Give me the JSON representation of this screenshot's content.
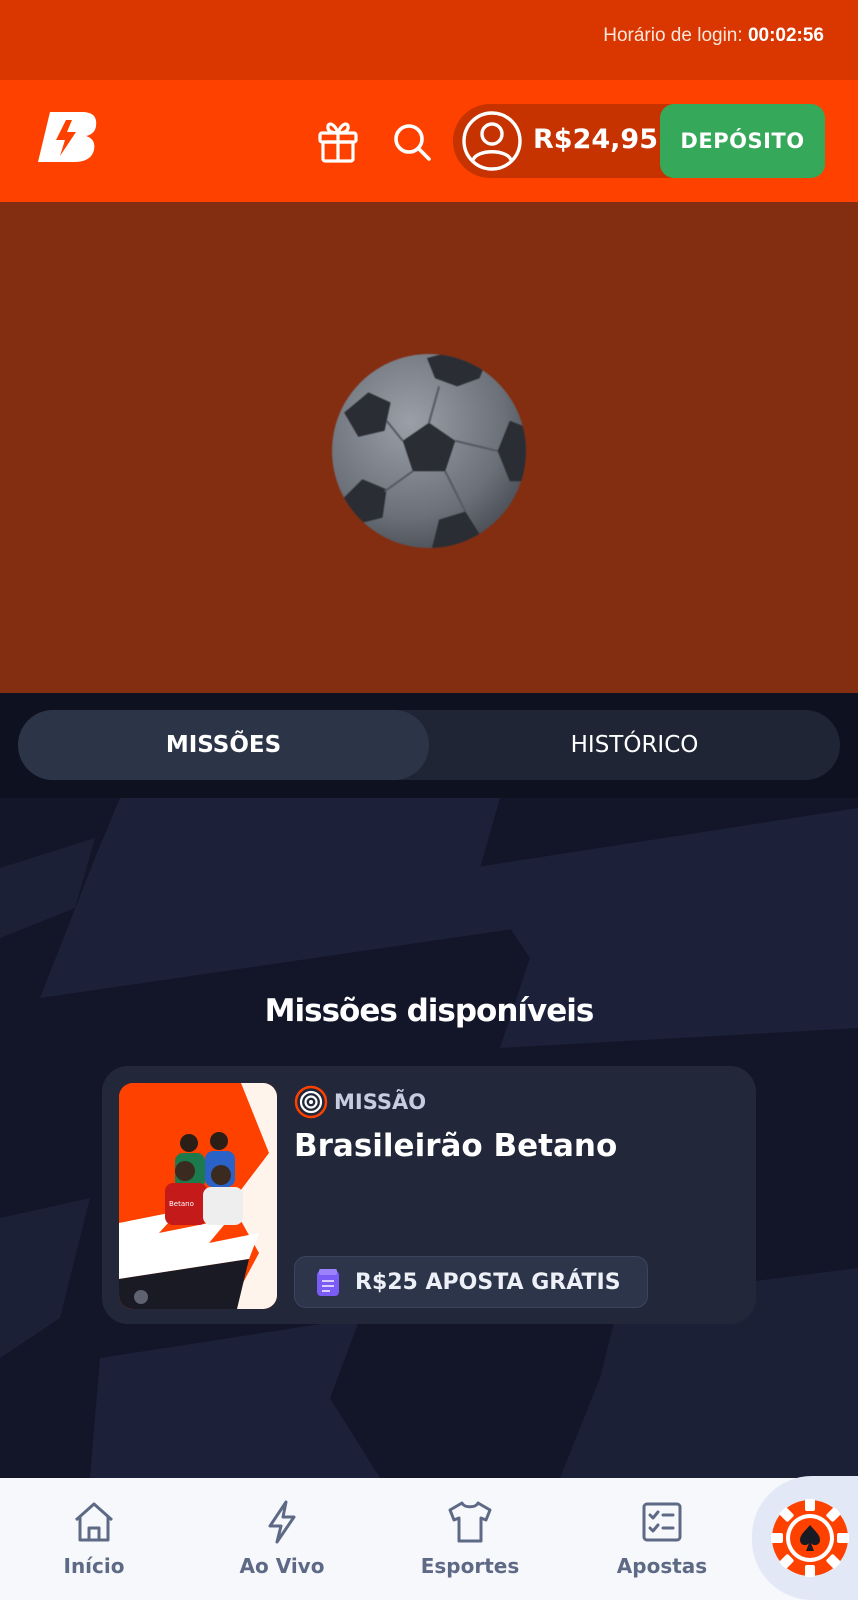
{
  "status_bar": {
    "login_label": "Horário de login:",
    "login_time": "00:02:56"
  },
  "header": {
    "logo_letter": "B",
    "balance": "R$24,95",
    "deposit_label": "DEPÓSITO",
    "icons": [
      "gift-icon",
      "search-icon",
      "user-avatar-icon"
    ]
  },
  "hero": {
    "image": "soccer-ball"
  },
  "tabs": {
    "items": [
      {
        "label": "MISSÕES",
        "active": true
      },
      {
        "label": "HISTÓRICO",
        "active": false
      }
    ]
  },
  "missions": {
    "section_title": "Missões disponíveis",
    "items": [
      {
        "tag": "MISSÃO",
        "title": "Brasileirão Betano",
        "reward": "R$25  APOSTA GRÁTIS",
        "thumb_brand": "Betano"
      }
    ]
  },
  "bottom_nav": {
    "items": [
      {
        "label": "Início",
        "icon": "home-icon"
      },
      {
        "label": "Ao Vivo",
        "icon": "lightning-icon"
      },
      {
        "label": "Esportes",
        "icon": "jersey-icon"
      },
      {
        "label": "Apostas",
        "icon": "checklist-icon"
      }
    ],
    "casino_icon": "casino-chip-icon"
  },
  "colors": {
    "brand_orange": "#ff4100",
    "status_bar": "#d93600",
    "hero_bg": "#832e11",
    "deposit_green": "#36a85a",
    "dark_bg": "#131629",
    "card_bg": "#22283a",
    "nav_text": "#5e6a85"
  }
}
